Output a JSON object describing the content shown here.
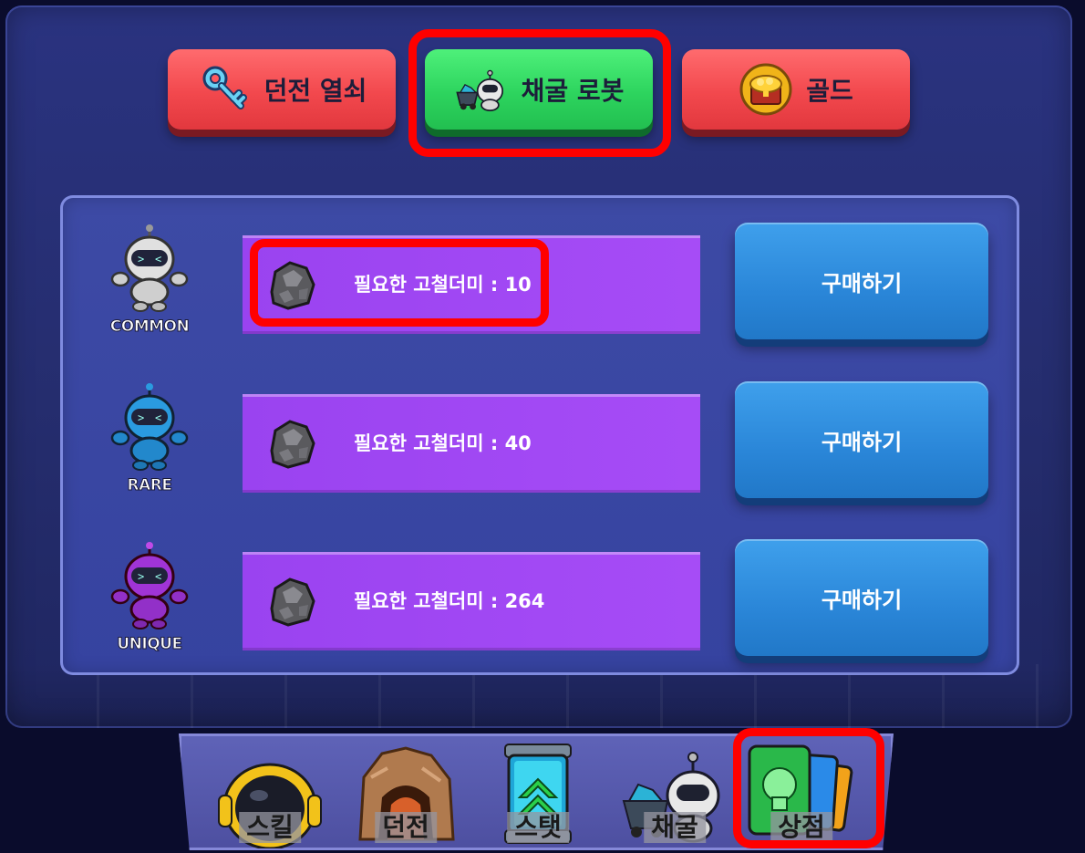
{
  "tabs": [
    {
      "label": "던전 열쇠",
      "icon": "key-icon",
      "color": "#f2484d",
      "selected": false
    },
    {
      "label": "채굴 로봇",
      "icon": "mining-robot-icon",
      "color": "#2dd45e",
      "selected": true
    },
    {
      "label": "골드",
      "icon": "gold-chest-icon",
      "color": "#f2484d",
      "selected": false
    }
  ],
  "shop_items": [
    {
      "rarity": "COMMON",
      "rarity_color": "#ffffff",
      "robot_color": "#d9d9d9",
      "cost_icon": "scrap-ore-icon",
      "cost_text": "필요한 고철더미 : 10",
      "buy_label": "구매하기"
    },
    {
      "rarity": "RARE",
      "rarity_color": "#ffffff",
      "robot_color": "#2a9be0",
      "cost_icon": "scrap-ore-icon",
      "cost_text": "필요한 고철더미 : 40",
      "buy_label": "구매하기"
    },
    {
      "rarity": "UNIQUE",
      "rarity_color": "#ffffff",
      "robot_color": "#a034d6",
      "cost_icon": "scrap-ore-icon",
      "cost_text": "필요한 고철더미 : 264",
      "buy_label": "구매하기"
    }
  ],
  "bottom_nav": [
    {
      "label": "스킬",
      "icon": "astronaut-helmet-icon"
    },
    {
      "label": "던전",
      "icon": "cave-dungeon-icon"
    },
    {
      "label": "스탯",
      "icon": "stat-upgrade-icon"
    },
    {
      "label": "채굴",
      "icon": "mining-robot-icon"
    },
    {
      "label": "상점",
      "icon": "shop-cards-icon",
      "selected": true
    }
  ],
  "colors": {
    "highlight": "#ff0000",
    "panel": "#2a3380",
    "cost_bar": "#a64cf6",
    "buy_button": "#2a86d8"
  }
}
